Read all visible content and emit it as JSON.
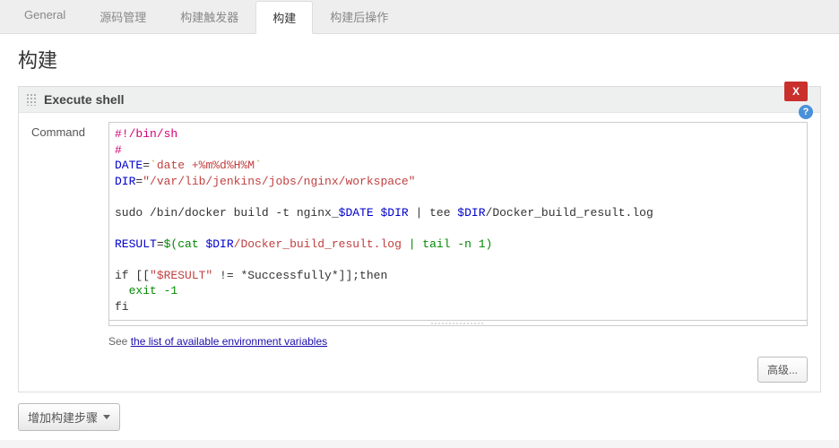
{
  "tabs": {
    "general": "General",
    "scm": "源码管理",
    "triggers": "构建触发器",
    "build": "构建",
    "postbuild": "构建后操作"
  },
  "section": {
    "title": "构建"
  },
  "step": {
    "title": "Execute shell",
    "delete_label": "X",
    "help_label": "?",
    "command_label": "Command",
    "script": {
      "line1": "#!/bin/sh",
      "line2": "#",
      "line3_a": "DATE",
      "line3_b": "=",
      "line3_c": "`",
      "line3_d": "date +%m%d%H%M",
      "line3_e": "`",
      "line4_a": "DIR",
      "line4_b": "=",
      "line4_c": "\"/var/lib/jenkins/jobs/nginx/workspace\"",
      "line5_a": "sudo /bin/docker build -t nginx_",
      "line5_b": "$DATE",
      "line5_c": " ",
      "line5_d": "$DIR",
      "line5_e": " | tee ",
      "line5_f": "$DIR",
      "line5_g": "/Docker_build_result.log",
      "line6_a": "RESULT",
      "line6_b": "=",
      "line6_c": "$(cat ",
      "line6_d": "$DIR",
      "line6_e": "/Docker_build_result.log",
      "line6_f": " | tail -n ",
      "line6_g": "1",
      "line6_h": ")",
      "line7_a": "if [[",
      "line7_b": "\"$RESULT\"",
      "line7_c": " != *Successfully*]];then",
      "line8": "  exit -1",
      "line9": "fi"
    },
    "hint_prefix": "See ",
    "hint_link": "the list of available environment variables",
    "advanced_label": "高级..."
  },
  "add_step": {
    "label": "增加构建步骤"
  }
}
